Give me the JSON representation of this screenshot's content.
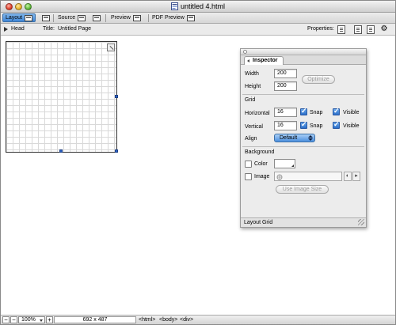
{
  "window": {
    "title": "untitled 4.html"
  },
  "modes": [
    {
      "label": "Layout",
      "icon": "layout-mode-icon",
      "active": true
    },
    {
      "label": "Source",
      "icon": "source-mode-icon",
      "active": false
    },
    {
      "label": "Preview",
      "icon": "preview-mode-icon",
      "active": false
    },
    {
      "label": "PDF Preview",
      "icon": "pdf-preview-mode-icon",
      "active": false
    }
  ],
  "headbar": {
    "head_label": "Head",
    "title_label": "Title:",
    "title_value": "Untitled Page",
    "properties_label": "Properties:"
  },
  "inspector": {
    "tab_label": "Inspector",
    "width_label": "Width",
    "width_value": "200",
    "height_label": "Height",
    "height_value": "200",
    "optimize_label": "Optimize",
    "grid_heading": "Grid",
    "horizontal_label": "Horizontal",
    "horizontal_value": "16",
    "vertical_label": "Vertical",
    "vertical_value": "16",
    "snap_label": "Snap",
    "visible_label": "Visible",
    "align_label": "Align",
    "align_value": "Default",
    "background_heading": "Background",
    "color_label": "Color",
    "image_label": "Image",
    "use_image_size_label": "Use Image Size",
    "footer_label": "Layout Grid"
  },
  "statusbar": {
    "zoom_value": "100%",
    "canvas_size": "692 x 487",
    "tags": [
      "<html>",
      "<body>",
      "<div>"
    ]
  },
  "colors": {
    "accent": "#3f86d6",
    "handle": "#2e63c6",
    "inspector_bg": "#ececec"
  }
}
